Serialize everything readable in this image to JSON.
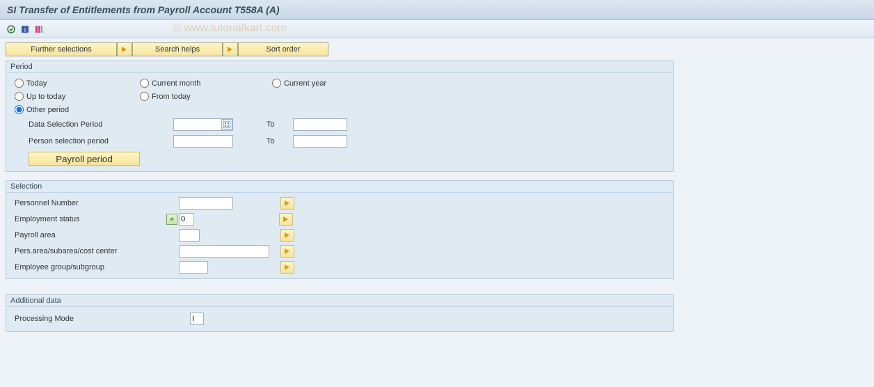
{
  "title": "SI Transfer of Entitlements from Payroll Account T558A (A)",
  "watermark": "© www.tutorialkart.com",
  "buttons": {
    "further": "Further selections",
    "search": "Search helps",
    "sort": "Sort order"
  },
  "period": {
    "legend": "Period",
    "radios": {
      "today": "Today",
      "current_month": "Current month",
      "current_year": "Current year",
      "up_to_today": "Up to today",
      "from_today": "From today",
      "other_period": "Other period"
    },
    "selected": "other_period",
    "data_selection_label": "Data Selection Period",
    "data_selection_from": "",
    "data_selection_to": "",
    "person_selection_label": "Person selection period",
    "person_selection_from": "",
    "person_selection_to": "",
    "to_label": "To",
    "payroll_btn": "Payroll period"
  },
  "selection": {
    "legend": "Selection",
    "personnel_number_label": "Personnel Number",
    "personnel_number": "",
    "employment_status_label": "Employment status",
    "employment_status": "0",
    "payroll_area_label": "Payroll area",
    "payroll_area": "",
    "pers_area_label": "Pers.area/subarea/cost center",
    "pers_area": "",
    "emp_group_label": "Employee group/subgroup",
    "emp_group": ""
  },
  "additional": {
    "legend": "Additional data",
    "processing_mode_label": "Processing Mode",
    "processing_mode": "I"
  }
}
